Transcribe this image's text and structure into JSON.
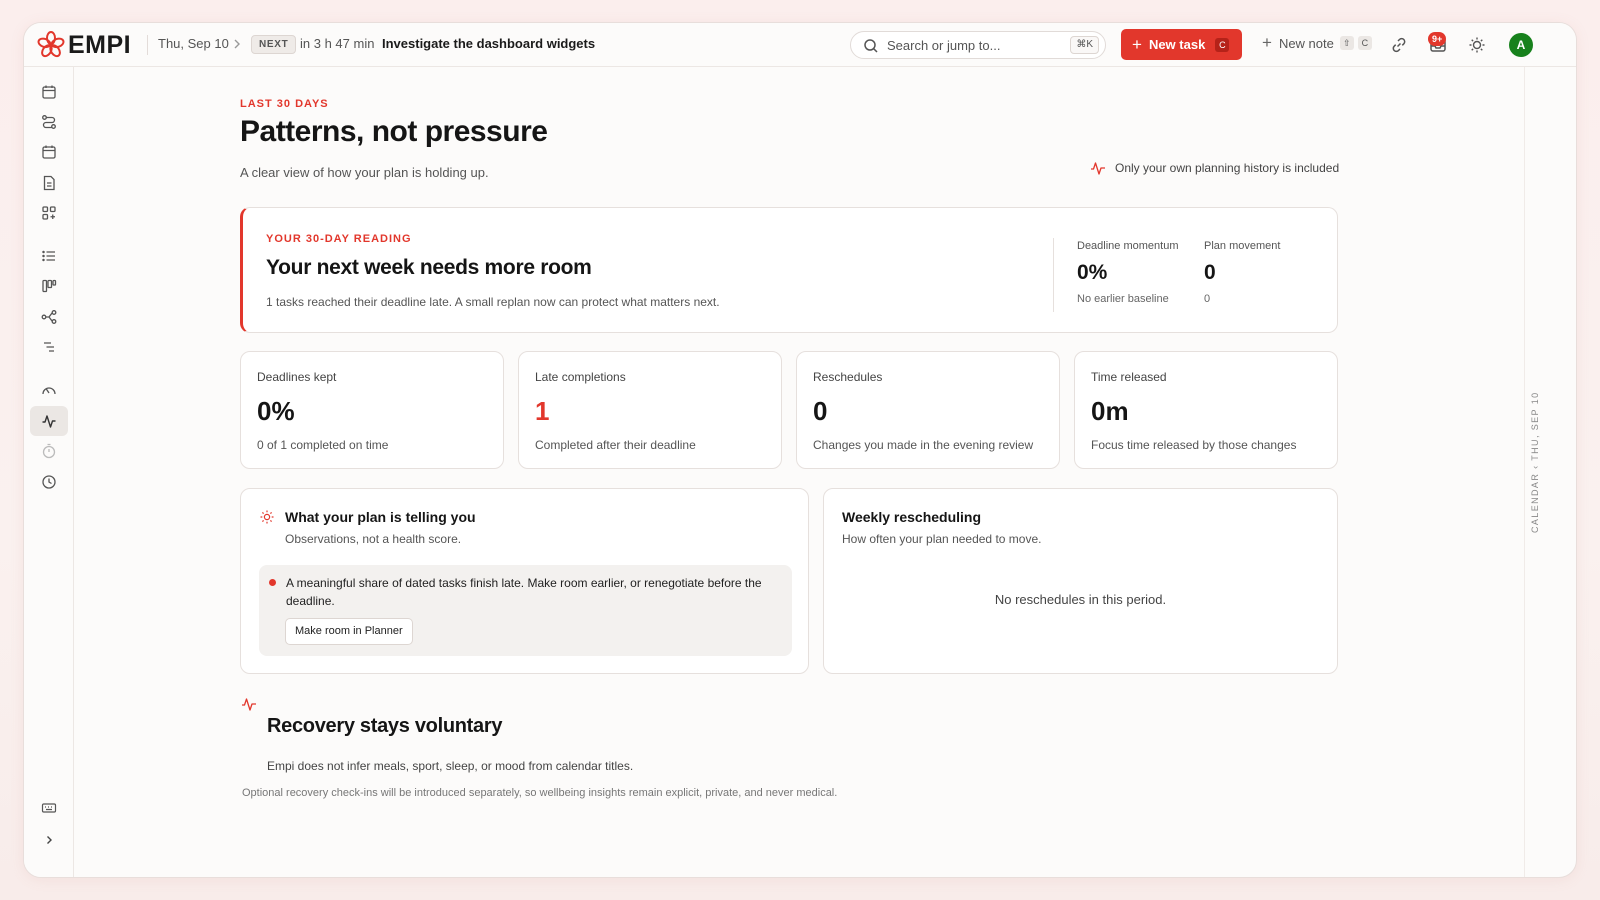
{
  "app": {
    "name": "EMPI",
    "accent": "#e2372c"
  },
  "topbar": {
    "date": "Thu, Sep 10",
    "next_badge": "NEXT",
    "next_in": "in 3 h 47 min",
    "next_title": "Investigate the dashboard widgets",
    "search_placeholder": "Search or jump to...",
    "search_shortcut": "⌘K",
    "new_task_label": "New task",
    "new_task_shortcut": "C",
    "new_note_label": "New note",
    "new_note_shortcut_1": "⇧",
    "new_note_shortcut_2": "C",
    "notifications_count": "9+",
    "avatar_initial": "A"
  },
  "sidebar": {
    "items": [
      {
        "name": "calendar-icon"
      },
      {
        "name": "routes-icon"
      },
      {
        "name": "calendar-alt-icon"
      },
      {
        "name": "document-icon"
      },
      {
        "name": "apps-icon"
      },
      {
        "name": "list-icon"
      },
      {
        "name": "board-icon"
      },
      {
        "name": "flow-icon"
      },
      {
        "name": "outline-icon"
      },
      {
        "name": "gauge-icon"
      },
      {
        "name": "activity-icon"
      },
      {
        "name": "timer-icon"
      },
      {
        "name": "clock-icon"
      },
      {
        "name": "keyboard-icon"
      },
      {
        "name": "chevron-right-icon"
      }
    ],
    "active": "activity-icon"
  },
  "rail": {
    "label": "CALENDAR  ‹  THU, SEP 10"
  },
  "main": {
    "eyebrow": "LAST 30 DAYS",
    "title": "Patterns, not pressure",
    "subtitle": "A clear view of how your plan is holding up.",
    "privacy_note": "Only your own planning history is included",
    "reading": {
      "eyebrow": "YOUR 30-DAY READING",
      "headline": "Your next week needs more room",
      "description": "1 tasks reached their deadline late. A small replan now can protect what matters next.",
      "momentum_label": "Deadline momentum",
      "momentum_value": "0%",
      "momentum_sub": "No earlier baseline",
      "movement_label": "Plan movement",
      "movement_value": "0",
      "movement_sub": "0"
    },
    "stats": [
      {
        "label": "Deadlines kept",
        "value": "0%",
        "sub": "0 of 1 completed on time"
      },
      {
        "label": "Late completions",
        "value": "1",
        "sub": "Completed after their deadline"
      },
      {
        "label": "Reschedules",
        "value": "0",
        "sub": "Changes you made in the evening review"
      },
      {
        "label": "Time released",
        "value": "0m",
        "sub": "Focus time released by those changes"
      }
    ],
    "insight": {
      "title": "What your plan is telling you",
      "subtitle": "Observations, not a health score.",
      "message": "A meaningful share of dated tasks finish late. Make room earlier, or renegotiate before the deadline.",
      "button": "Make room in Planner"
    },
    "weekly": {
      "title": "Weekly rescheduling",
      "subtitle": "How often your plan needed to move.",
      "empty": "No reschedules in this period."
    },
    "recovery": {
      "title": "Recovery stays voluntary",
      "description": "Empi does not infer meals, sport, sleep, or mood from calendar titles.",
      "note": "Optional recovery check-ins will be introduced separately, so wellbeing insights remain explicit, private, and never medical."
    }
  }
}
